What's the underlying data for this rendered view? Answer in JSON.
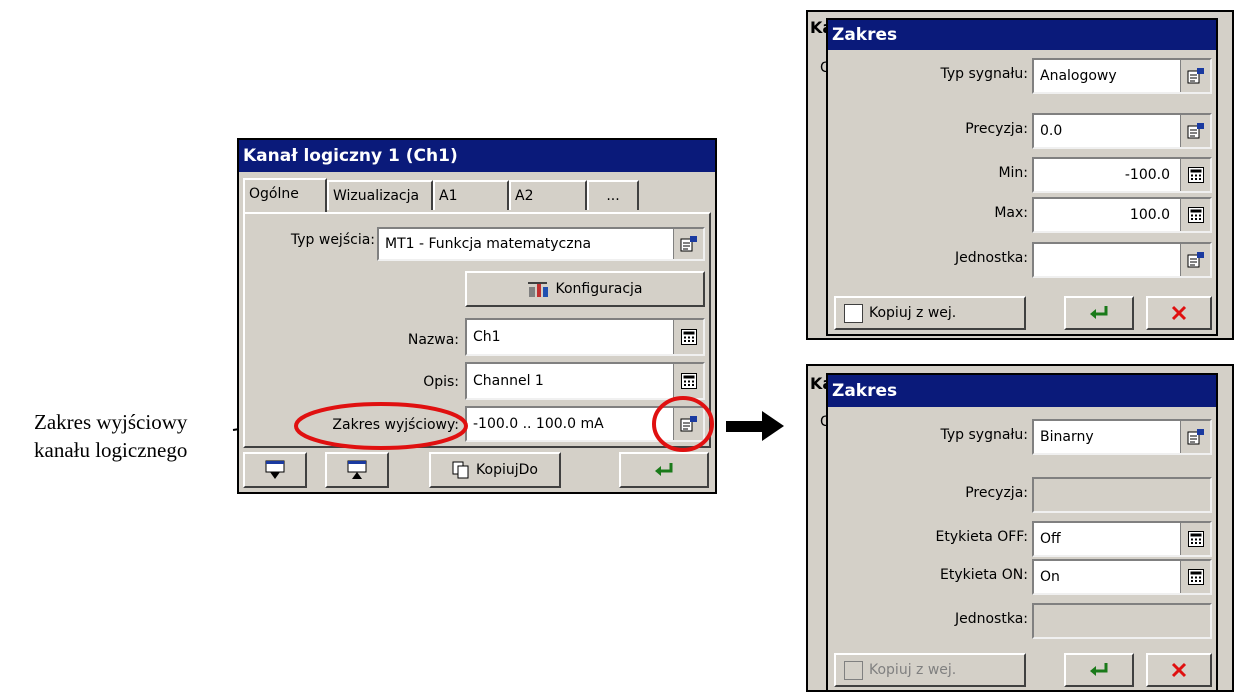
{
  "annotation": {
    "line1": "Zakres wyjściowy",
    "line2": "kanału logicznego"
  },
  "main": {
    "title": "Kanał logiczny 1 (Ch1)",
    "tabs": [
      "Ogólne",
      "Wizualizacja",
      "A1",
      "A2",
      "..."
    ],
    "input_type": {
      "label": "Typ wejścia:",
      "value": "MT1 - Funkcja matematyczna"
    },
    "config_label": "Konfiguracja",
    "name": {
      "label": "Nazwa:",
      "value": "Ch1"
    },
    "desc": {
      "label": "Opis:",
      "value": "Channel 1"
    },
    "range": {
      "label": "Zakres wyjściowy:",
      "value": "-100.0 .. 100.0 mA"
    },
    "copyto_label": "KopiujDo"
  },
  "ghost": {
    "letters_title": "Ka",
    "letter_c": "C"
  },
  "dialog_analog": {
    "title": "Zakres",
    "signal": {
      "label": "Typ sygnału:",
      "value": "Analogowy"
    },
    "precision": {
      "label": "Precyzja:",
      "value": "0.0"
    },
    "min": {
      "label": "Min:",
      "value": "-100.0"
    },
    "max": {
      "label": "Max:",
      "value": "100.0"
    },
    "unit": {
      "label": "Jednostka:",
      "value": ""
    },
    "copy_label": "Kopiuj z wej."
  },
  "dialog_binary": {
    "title": "Zakres",
    "signal": {
      "label": "Typ sygnału:",
      "value": "Binarny"
    },
    "precision": {
      "label": "Precyzja:",
      "value": ""
    },
    "off": {
      "label": "Etykieta OFF:",
      "value": "Off"
    },
    "on": {
      "label": "Etykieta ON:",
      "value": "On"
    },
    "unit": {
      "label": "Jednostka:",
      "value": ""
    },
    "copy_label": "Kopiuj z wej."
  },
  "colors": {
    "titlebar": "#0a1a7a",
    "highlight": "#e01010",
    "cancel": "#e01010",
    "enter": "#1a7a1a"
  }
}
